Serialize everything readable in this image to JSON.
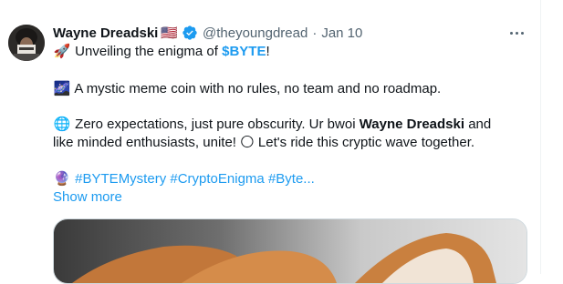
{
  "tweet": {
    "author_name": "Wayne Dreadski",
    "author_flag": "🇺🇸",
    "handle": "@theyoungdread",
    "separator": "·",
    "date": "Jan 10",
    "lines": [
      {
        "emoji": "🚀",
        "parts": [
          "Unveiling the enigma of ",
          "$BYTE",
          "!"
        ]
      },
      {
        "emoji": "🌌",
        "parts": [
          "A mystic meme coin with no rules, no team and no roadmap."
        ]
      },
      {
        "emoji": "🌐",
        "parts": [
          "Zero expectations, just pure obscurity. Ur bwoi ",
          "Wayne Dreadski",
          " and"
        ]
      },
      {
        "parts": [
          "like minded enthusiasts, unite! ",
          "🌕",
          " Let's ride this cryptic wave together."
        ]
      },
      {
        "emoji": "🔮",
        "hashtags": [
          "#BYTEMystery",
          "#CryptoEnigma",
          "#Byte..."
        ]
      }
    ],
    "show_more": "Show more"
  },
  "icons": {
    "verified": "verified-badge-icon",
    "more": "more-options-icon"
  },
  "colors": {
    "link": "#1d9bf0",
    "secondary_text": "#536471",
    "primary_text": "#0f1419",
    "border": "#cfd9de"
  }
}
